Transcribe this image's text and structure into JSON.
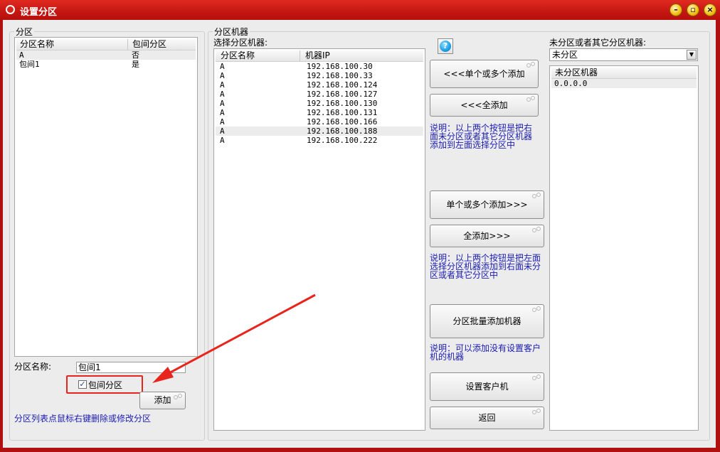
{
  "window": {
    "title": "设置分区"
  },
  "left": {
    "group_label": "分区",
    "columns": [
      "分区名称",
      "包间分区"
    ],
    "rows": [
      {
        "name": "A",
        "room": "否"
      },
      {
        "name": "包间1",
        "room": "是"
      }
    ],
    "name_label": "分区名称:",
    "name_value": "包间1",
    "checkbox_label": "包间分区",
    "checkbox_checked": true,
    "add_button": "添加",
    "hint": "分区列表点鼠标右键删除或修改分区"
  },
  "middle": {
    "group_label": "分区机器",
    "sublabel": "选择分区机器:",
    "columns": [
      "分区名称",
      "机器IP"
    ],
    "rows": [
      {
        "name": "A",
        "ip": "192.168.100.30"
      },
      {
        "name": "A",
        "ip": "192.168.100.33"
      },
      {
        "name": "A",
        "ip": "192.168.100.124"
      },
      {
        "name": "A",
        "ip": "192.168.100.127"
      },
      {
        "name": "A",
        "ip": "192.168.100.130"
      },
      {
        "name": "A",
        "ip": "192.168.100.131"
      },
      {
        "name": "A",
        "ip": "192.168.100.166"
      },
      {
        "name": "A",
        "ip": "192.168.100.188"
      },
      {
        "name": "A",
        "ip": "192.168.100.222"
      }
    ]
  },
  "actions": {
    "help_icon": "question-icon",
    "add_selected_left": "<<<单个或多个添加",
    "add_all_left": "<<<全添加",
    "note1": [
      "说明：以上两个按钮是把右",
      "面未分区或者其它分区机器",
      "添加到左面选择分区中"
    ],
    "add_selected_right": "单个或多个添加>>>",
    "add_all_right": "全添加>>>",
    "note2": [
      "说明：以上两个按钮是把左面",
      "选择分区机器添加到右面未分",
      "区或者其它分区中"
    ],
    "batch_add": "分区批量添加机器",
    "note3": [
      "说明：可以添加没有设置客户",
      "机的机器"
    ],
    "set_client": "设置客户机",
    "back": "返回"
  },
  "right": {
    "label": "未分区或者其它分区机器:",
    "select_value": "未分区",
    "column": "未分区机器",
    "rows": [
      "0.0.0.0"
    ]
  }
}
